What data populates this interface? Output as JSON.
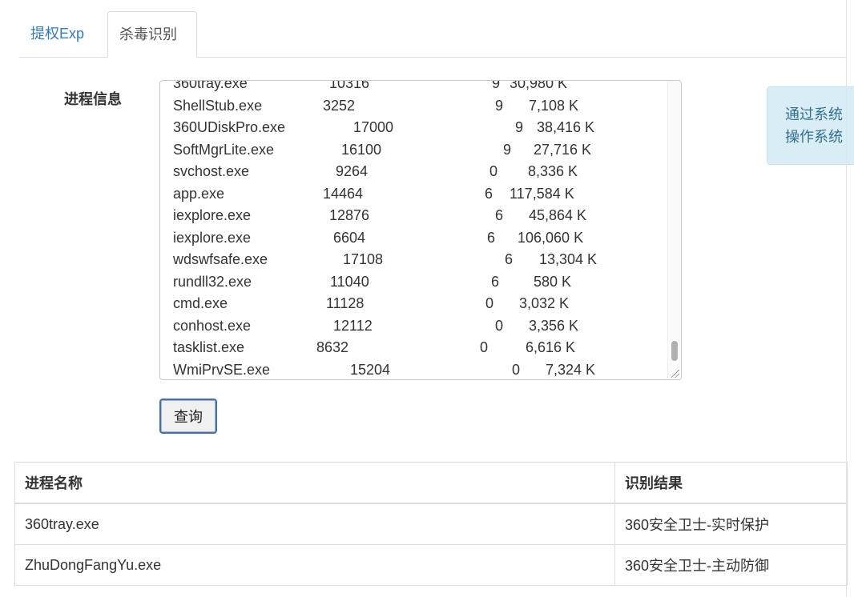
{
  "tabs": [
    {
      "label": "提权Exp",
      "active": false
    },
    {
      "label": "杀毒识别",
      "active": true
    }
  ],
  "form": {
    "label": "进程信息",
    "button_label": "查询"
  },
  "process_list": [
    {
      "name": "360tray.exe",
      "pid": "10316",
      "session": "9",
      "mem": "30,980 K"
    },
    {
      "name": "ShellStub.exe",
      "pid": "3252",
      "session": "9",
      "mem": "7,108 K"
    },
    {
      "name": "360UDiskPro.exe",
      "pid": "17000",
      "session": "9",
      "mem": "38,416 K"
    },
    {
      "name": "SoftMgrLite.exe",
      "pid": "16100",
      "session": "9",
      "mem": "27,716 K"
    },
    {
      "name": "svchost.exe",
      "pid": "9264",
      "session": "0",
      "mem": "8,336 K"
    },
    {
      "name": "app.exe",
      "pid": "14464",
      "session": "6",
      "mem": "117,584 K"
    },
    {
      "name": "iexplore.exe",
      "pid": "12876",
      "session": "6",
      "mem": "45,864 K"
    },
    {
      "name": "iexplore.exe",
      "pid": "6604",
      "session": "6",
      "mem": "106,060 K"
    },
    {
      "name": "wdswfsafe.exe",
      "pid": "17108",
      "session": "6",
      "mem": "13,304 K"
    },
    {
      "name": "rundll32.exe",
      "pid": "11040",
      "session": "6",
      "mem": "580 K"
    },
    {
      "name": "cmd.exe",
      "pid": "11128",
      "session": "0",
      "mem": "3,032 K"
    },
    {
      "name": "conhost.exe",
      "pid": "12112",
      "session": "0",
      "mem": "3,356 K"
    },
    {
      "name": "tasklist.exe",
      "pid": "8632",
      "session": "0",
      "mem": "6,616 K"
    },
    {
      "name": "WmiPrvSE.exe",
      "pid": "15204",
      "session": "0",
      "mem": "7,324 K"
    }
  ],
  "info_box": {
    "line1": "通过系统",
    "line2": "操作系统"
  },
  "table": {
    "headers": [
      "进程名称",
      "识别结果"
    ],
    "rows": [
      [
        "360tray.exe",
        "360安全卫士-实时保护"
      ],
      [
        "ZhuDongFangYu.exe",
        "360安全卫士-主动防御"
      ]
    ]
  }
}
